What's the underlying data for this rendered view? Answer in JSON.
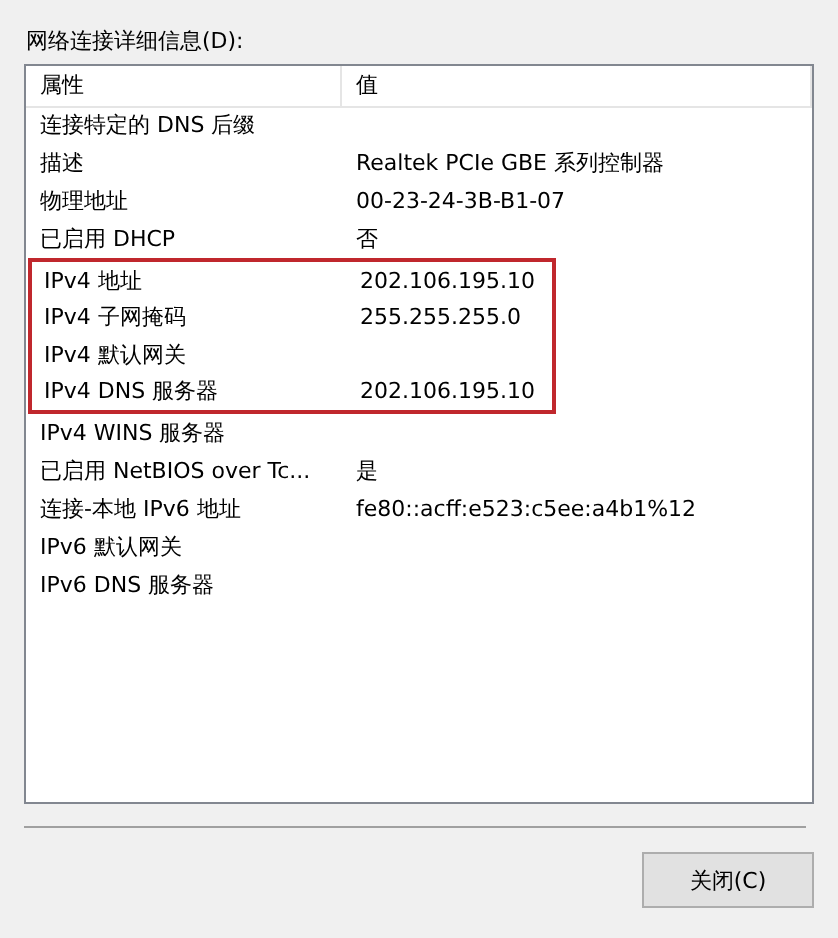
{
  "label": "网络连接详细信息(D):",
  "table": {
    "columns": [
      "属性",
      "值"
    ],
    "rows": [
      {
        "property": "连接特定的 DNS 后缀",
        "value": "",
        "highlighted": false
      },
      {
        "property": "描述",
        "value": "Realtek PCIe GBE 系列控制器",
        "highlighted": false
      },
      {
        "property": "物理地址",
        "value": "00-23-24-3B-B1-07",
        "highlighted": false
      },
      {
        "property": "已启用 DHCP",
        "value": "否",
        "highlighted": false
      },
      {
        "property": "IPv4 地址",
        "value": "202.106.195.10",
        "highlighted": true
      },
      {
        "property": "IPv4 子网掩码",
        "value": "255.255.255.0",
        "highlighted": true
      },
      {
        "property": "IPv4 默认网关",
        "value": "",
        "highlighted": true
      },
      {
        "property": "IPv4 DNS 服务器",
        "value": "202.106.195.10",
        "highlighted": true
      },
      {
        "property": "IPv4 WINS 服务器",
        "value": "",
        "highlighted": false
      },
      {
        "property": "已启用 NetBIOS over Tc...",
        "value": "是",
        "highlighted": false
      },
      {
        "property": "连接-本地 IPv6 地址",
        "value": "fe80::acff:e523:c5ee:a4b1%12",
        "highlighted": false
      },
      {
        "property": "IPv6 默认网关",
        "value": "",
        "highlighted": false
      },
      {
        "property": "IPv6 DNS 服务器",
        "value": "",
        "highlighted": false
      }
    ]
  },
  "buttons": [
    "关闭(C)"
  ]
}
